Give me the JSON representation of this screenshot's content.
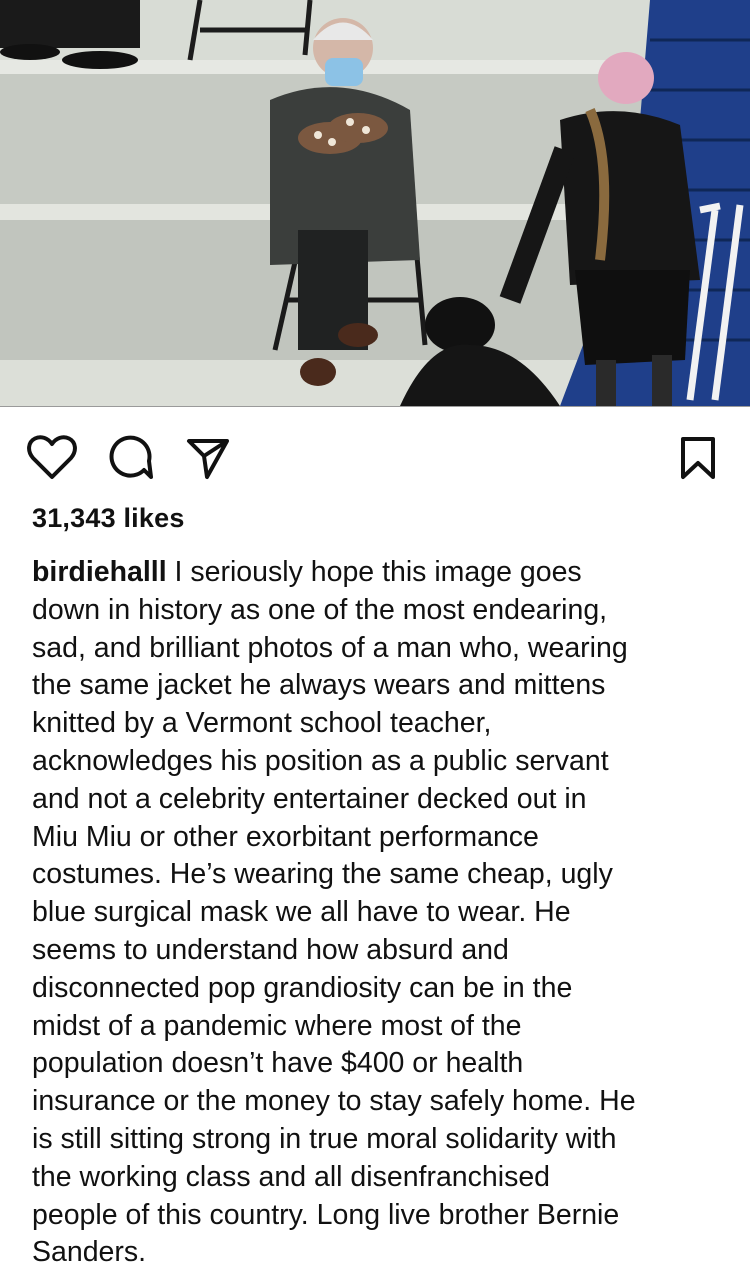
{
  "post": {
    "image_icon": "post-photo",
    "actions": {
      "like_icon": "heart-icon",
      "comment_icon": "comment-bubble-icon",
      "share_icon": "paper-plane-icon",
      "save_icon": "bookmark-icon"
    },
    "likes_text": "31,343 likes",
    "username": "birdiehalll",
    "caption_lines": [
      " I seriously hope this image goes",
      "down in history as one of the most endearing,",
      "sad, and brilliant photos of a man who, wearing",
      "the same jacket he always wears and mittens",
      "knitted by a Vermont school teacher,",
      "acknowledges his position as a public servant",
      "and not a celebrity entertainer decked out in",
      "Miu Miu or other exorbitant performance",
      "costumes. He’s wearing the same cheap, ugly",
      "blue surgical mask we all have to wear. He",
      "seems to understand how absurd and",
      "disconnected pop grandiosity can be in the",
      "midst of a pandemic where most of the",
      "population doesn’t have $400 or health",
      "insurance or the money to stay safely home. He",
      "is still sitting strong in true moral solidarity with",
      "the working class and all disenfranchised",
      "people of this country. Long live brother Bernie",
      "Sanders."
    ]
  }
}
